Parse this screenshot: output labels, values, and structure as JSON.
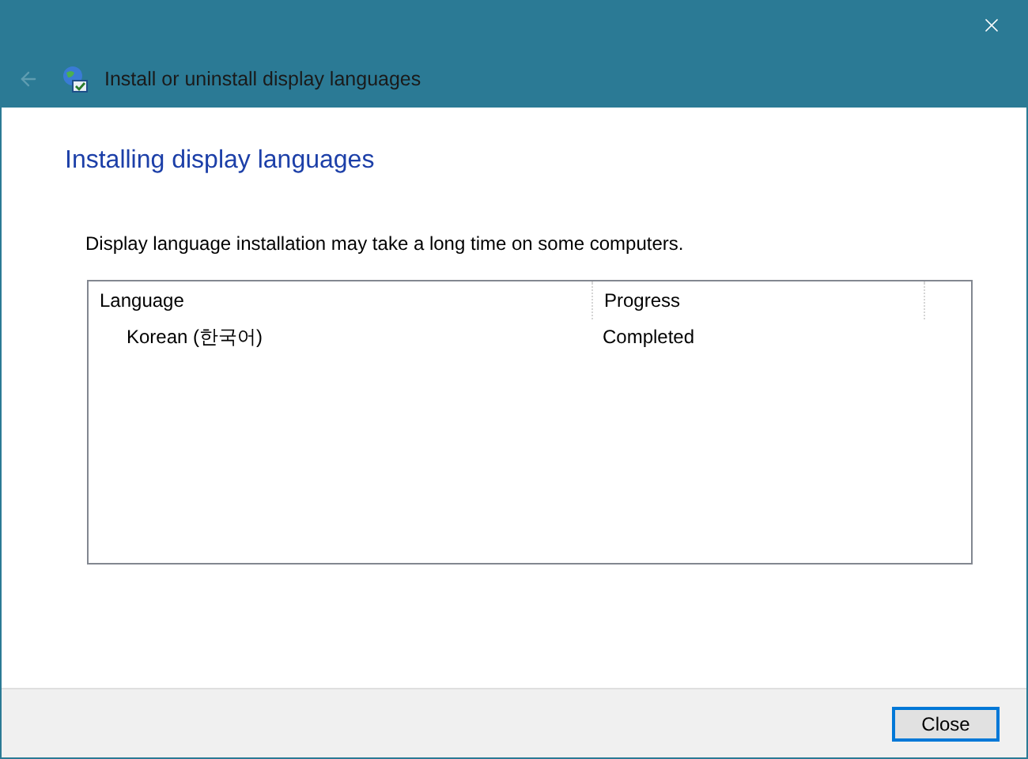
{
  "window": {
    "title": "Install or uninstall display languages"
  },
  "back_button": {
    "disabled": true
  },
  "heading": "Installing display languages",
  "description": "Display language installation may take a long time on some computers.",
  "table": {
    "columns": [
      "Language",
      "Progress"
    ],
    "rows": [
      {
        "language": "Korean (한국어)",
        "progress": "Completed"
      }
    ]
  },
  "buttons": [
    {
      "label": "Close",
      "selected": true
    }
  ]
}
